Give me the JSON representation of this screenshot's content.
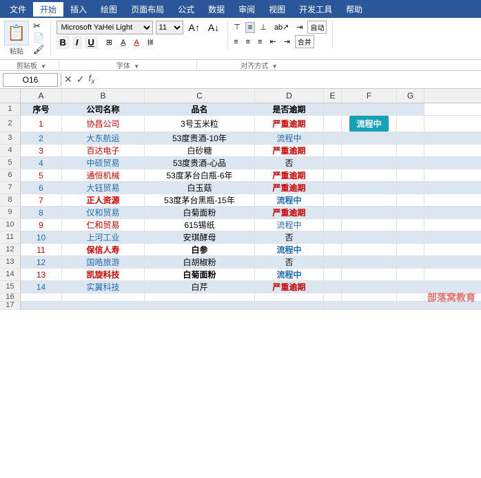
{
  "menuBar": {
    "items": [
      "文件",
      "开始",
      "插入",
      "绘图",
      "页面布局",
      "公式",
      "数据",
      "审阅",
      "视图",
      "开发工具",
      "帮助"
    ],
    "activeItem": "开始"
  },
  "ribbon": {
    "pasteLabel": "粘贴",
    "clipboardLabel": "剪贴板",
    "fontName": "Microsoft YaHei Light",
    "fontSize": "11",
    "fontSectionLabel": "字体",
    "alignSectionLabel": "对齐方式",
    "autoWrapLabel": "自动",
    "mergeLabel": "合并",
    "buttons": {
      "bold": "B",
      "italic": "I",
      "underline": "U"
    }
  },
  "formulaBar": {
    "cellRef": "O16",
    "formula": ""
  },
  "columns": {
    "headers": [
      "A",
      "B",
      "C",
      "D",
      "E",
      "F",
      "G"
    ]
  },
  "tableHeaders": {
    "a": "序号",
    "b": "公司名称",
    "c": "品名",
    "d": "是否逾期"
  },
  "rows": [
    {
      "num": 1,
      "a": "1",
      "b": "协昌公司",
      "c": "3号玉米粒",
      "d": "严重逾期",
      "aStyle": "red",
      "bStyle": "red",
      "cStyle": "normal",
      "dStyle": "severe"
    },
    {
      "num": 2,
      "a": "2",
      "b": "大东航运",
      "c": "53度贵酒-10年",
      "d": "流程中",
      "aStyle": "blue",
      "bStyle": "blue",
      "cStyle": "normal",
      "dStyle": "process"
    },
    {
      "num": 3,
      "a": "3",
      "b": "百达电子",
      "c": "白砂糖",
      "d": "严重逾期",
      "aStyle": "red",
      "bStyle": "red",
      "cStyle": "normal",
      "dStyle": "severe"
    },
    {
      "num": 4,
      "a": "4",
      "b": "中硕贸易",
      "c": "53度贵酒-心品",
      "d": "否",
      "aStyle": "blue",
      "bStyle": "blue",
      "cStyle": "normal",
      "dStyle": "no"
    },
    {
      "num": 5,
      "a": "5",
      "b": "通恒机械",
      "c": "53度茅台白瓶-6年",
      "d": "严重逾期",
      "aStyle": "red",
      "bStyle": "red",
      "cStyle": "normal",
      "dStyle": "severe"
    },
    {
      "num": 6,
      "a": "6",
      "b": "大钰贸易",
      "c": "白玉菇",
      "d": "严重逾期",
      "aStyle": "blue",
      "bStyle": "blue",
      "cStyle": "normal",
      "dStyle": "severe"
    },
    {
      "num": 7,
      "a": "7",
      "b": "正人资源",
      "c": "53度茅台黑瓶-15年",
      "d": "流程中",
      "aStyle": "red",
      "bStyle": "red bold",
      "cStyle": "normal",
      "dStyle": "process bold"
    },
    {
      "num": 8,
      "a": "8",
      "b": "仪和贸易",
      "c": "白菊面粉",
      "d": "严重逾期",
      "aStyle": "blue",
      "bStyle": "blue",
      "cStyle": "normal",
      "dStyle": "severe"
    },
    {
      "num": 9,
      "a": "9",
      "b": "仁和贸易",
      "c": "615锡纸",
      "d": "流程中",
      "aStyle": "red",
      "bStyle": "red",
      "cStyle": "normal",
      "dStyle": "process"
    },
    {
      "num": 10,
      "a": "10",
      "b": "上河工业",
      "c": "安琪酵母",
      "d": "否",
      "aStyle": "blue",
      "bStyle": "blue",
      "cStyle": "normal",
      "dStyle": "no"
    },
    {
      "num": 11,
      "a": "11",
      "b": "保信人寿",
      "c": "白参",
      "d": "流程中",
      "aStyle": "red",
      "bStyle": "red bold",
      "cStyle": "normal bold",
      "dStyle": "process bold"
    },
    {
      "num": 12,
      "a": "12",
      "b": "国皓旅游",
      "c": "白胡椒粉",
      "d": "否",
      "aStyle": "blue",
      "bStyle": "blue",
      "cStyle": "normal",
      "dStyle": "no"
    },
    {
      "num": 13,
      "a": "13",
      "b": "凯旋科技",
      "c": "白菊面粉",
      "d": "流程中",
      "aStyle": "red",
      "bStyle": "red bold",
      "cStyle": "normal bold",
      "dStyle": "process bold"
    },
    {
      "num": 14,
      "a": "14",
      "b": "实翼科技",
      "c": "白芹",
      "d": "严重逾期",
      "aStyle": "blue",
      "bStyle": "blue",
      "cStyle": "normal",
      "dStyle": "severe"
    }
  ],
  "badge": {
    "text": "流程中",
    "rowF2": "流程中"
  },
  "watermark": "部落窝教育"
}
